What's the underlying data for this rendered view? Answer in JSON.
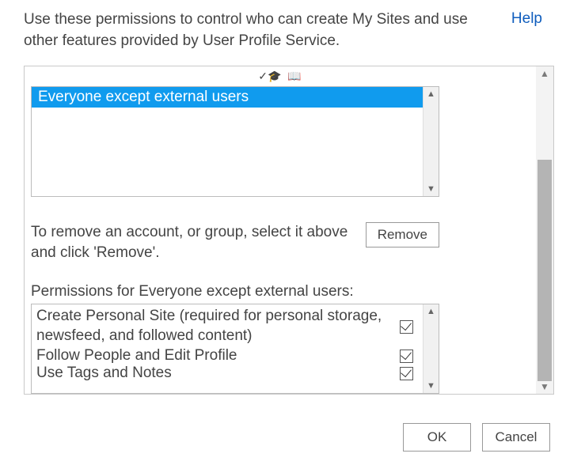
{
  "header": {
    "description": "Use these permissions to control who can create My Sites and use other features provided by User Profile Service.",
    "help_label": "Help"
  },
  "toolbar": {
    "icon1_name": "check-names-icon",
    "icon2_name": "browse-icon"
  },
  "accounts_list": {
    "selected_item": "Everyone except external users"
  },
  "remove": {
    "instruction": "To remove an account, or group, select it above and click 'Remove'.",
    "button_label": "Remove"
  },
  "permissions": {
    "label": "Permissions for Everyone except external users:",
    "items": [
      {
        "text": "Create Personal Site (required for personal storage, newsfeed, and followed content)",
        "checked": true
      },
      {
        "text": "Follow People and Edit Profile",
        "checked": true
      },
      {
        "text": "Use Tags and Notes",
        "checked": true
      }
    ]
  },
  "footer": {
    "ok_label": "OK",
    "cancel_label": "Cancel"
  }
}
